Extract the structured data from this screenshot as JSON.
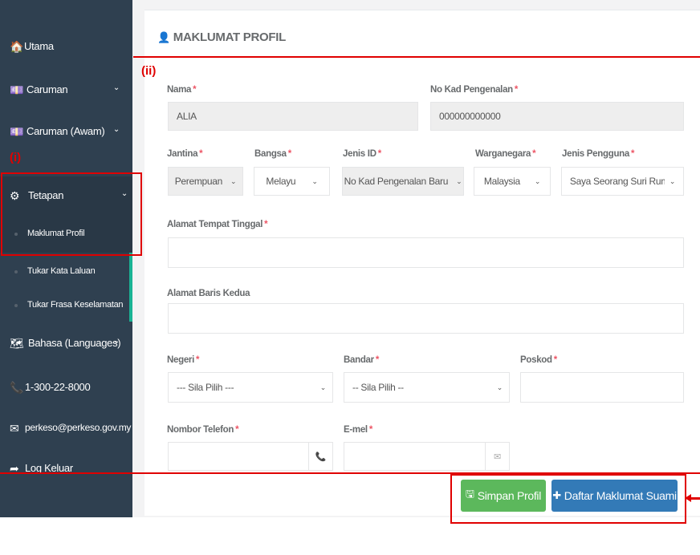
{
  "sidebar": {
    "items": [
      {
        "label": "Utama",
        "icon": "home-icon",
        "glyph": "🏠"
      },
      {
        "label": "Caruman",
        "icon": "money-icon",
        "glyph": "💷"
      },
      {
        "label": "Caruman (Awam)",
        "icon": "money-icon",
        "glyph": "💷"
      },
      {
        "label": "Tetapan",
        "icon": "gear-icon",
        "glyph": "⚙"
      },
      {
        "label": "Bahasa (Languages)",
        "icon": "language-icon",
        "glyph": "🗺"
      },
      {
        "label": "1-300-22-8000",
        "icon": "phone-icon",
        "glyph": "📞"
      },
      {
        "label": "perkeso@perkeso.gov.my",
        "icon": "envelope-icon",
        "glyph": "✉"
      },
      {
        "label": "Log Keluar",
        "icon": "sign-out-icon",
        "glyph": "➦"
      }
    ],
    "submenu": [
      {
        "label": "Maklumat Profil"
      },
      {
        "label": "Tukar Kata Laluan"
      },
      {
        "label": "Tukar Frasa Keselamatan"
      }
    ],
    "chevron": "⌄"
  },
  "page": {
    "title_icon": "user-icon",
    "title_glyph": "👤",
    "title": "MAKLUMAT PROFIL"
  },
  "form": {
    "required_mark": "*",
    "nama": {
      "label": "Nama",
      "value": "ALIA"
    },
    "ic": {
      "label": "No Kad Pengenalan",
      "value": "000000000000"
    },
    "jantina": {
      "label": "Jantina",
      "value": "Perempuan"
    },
    "bangsa": {
      "label": "Bangsa",
      "value": "Melayu"
    },
    "jenis_id": {
      "label": "Jenis ID",
      "value": "No Kad Pengenalan Baru"
    },
    "warganegara": {
      "label": "Warganegara",
      "value": "Malaysia"
    },
    "jenis_pengguna": {
      "label": "Jenis Pengguna",
      "value": "Saya Seorang Suri Rumah"
    },
    "alamat1": {
      "label": "Alamat Tempat Tinggal",
      "value": ""
    },
    "alamat2": {
      "label": "Alamat Baris Kedua",
      "value": ""
    },
    "negeri": {
      "label": "Negeri",
      "value": "--- Sila Pilih ---"
    },
    "bandar": {
      "label": "Bandar",
      "value": "-- Sila Pilih --"
    },
    "poskod": {
      "label": "Poskod",
      "value": ""
    },
    "telefon": {
      "label": "Nombor Telefon",
      "value": "",
      "icon": "phone-icon",
      "glyph": "📞"
    },
    "emel": {
      "label": "E-mel",
      "value": "",
      "icon": "envelope-icon",
      "glyph": "✉"
    },
    "caret": "⌄"
  },
  "buttons": {
    "save": {
      "label": "Simpan Profil",
      "icon": "save-icon",
      "glyph": "🖫"
    },
    "add": {
      "label": "Daftar Maklumat Suami",
      "icon": "plus-icon",
      "glyph": "✚"
    }
  },
  "annotations": {
    "i": "(i)",
    "ii": "(ii)"
  },
  "colors": {
    "sidebar_bg": "#2f4050",
    "active_bg": "#293846",
    "accent": "#1ab394",
    "save_btn": "#5cb85c",
    "add_btn": "#337ab7",
    "annotation": "#e00000",
    "required": "#ed5565"
  }
}
